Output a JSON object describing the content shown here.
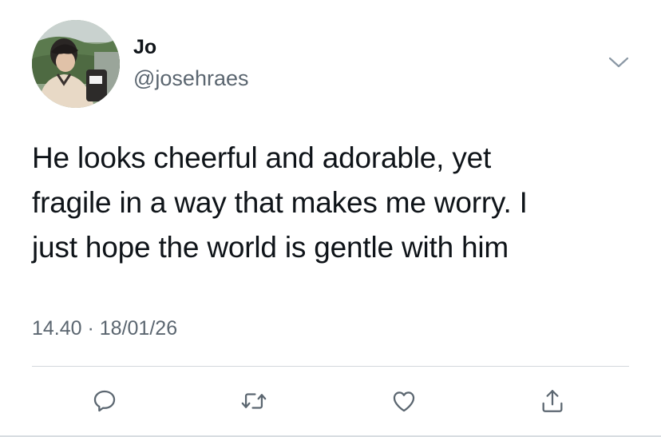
{
  "tweet": {
    "author": {
      "display_name": "Jo",
      "handle": "@josehraes"
    },
    "text_lines": [
      "He looks cheerful and adorable, yet",
      "fragile in a way that makes me worry. I",
      "just hope the world is gentle with him"
    ],
    "timestamp": "14.40 · 18/01/26"
  },
  "icons": {
    "menu": "chevron-down-icon",
    "reply": "speech-bubble-icon",
    "retweet": "retweet-arrows-icon",
    "like": "heart-icon",
    "share": "share-upload-icon"
  },
  "colors": {
    "text_primary": "#0f1419",
    "text_secondary": "#5b6670",
    "icon_gray": "#5b6670",
    "divider": "#d3d8dc",
    "background": "#ffffff"
  }
}
